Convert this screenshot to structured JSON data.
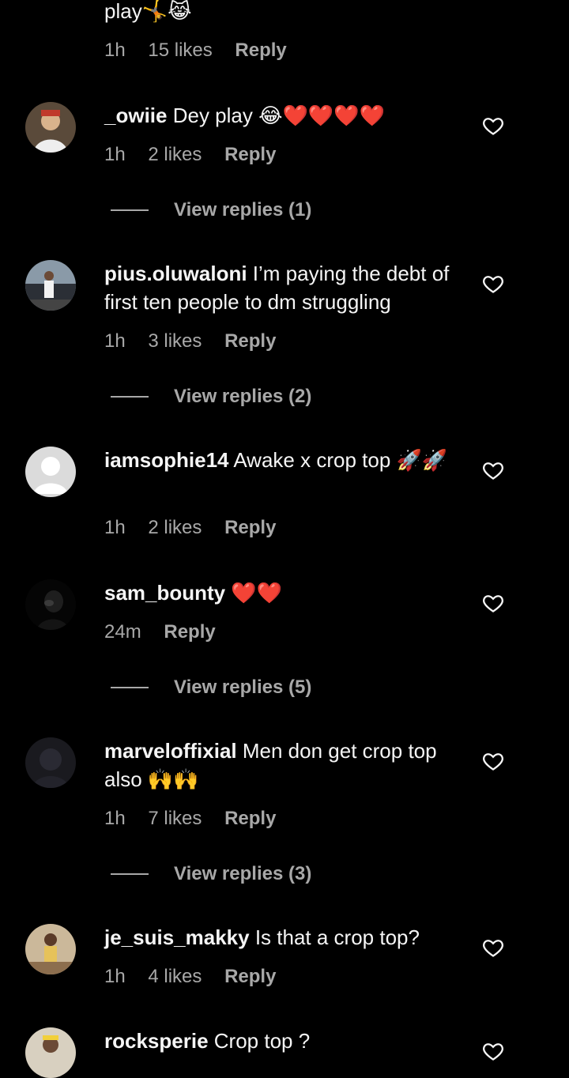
{
  "comments": [
    {
      "username": "",
      "text": "play🤸😹",
      "time": "1h",
      "likes": "15 likes",
      "reply_label": "Reply"
    },
    {
      "username": "_owiie",
      "text": "Dey play 😂❤️❤️❤️❤️",
      "time": "1h",
      "likes": "2 likes",
      "reply_label": "Reply",
      "view_replies": "View replies (1)"
    },
    {
      "username": "pius.oluwaloni",
      "text": "I’m paying the debt of first ten people to dm struggling",
      "time": "1h",
      "likes": "3 likes",
      "reply_label": "Reply",
      "view_replies": "View replies (2)"
    },
    {
      "username": "iamsophie14",
      "text": "Awake x crop top 🚀🚀",
      "time": "1h",
      "likes": "2 likes",
      "reply_label": "Reply"
    },
    {
      "username": "sam_bounty",
      "text": "❤️❤️",
      "time": "24m",
      "likes": "",
      "reply_label": "Reply",
      "view_replies": "View replies (5)"
    },
    {
      "username": "marveloffixial",
      "text": "Men don get crop top also 🙌🙌",
      "time": "1h",
      "likes": "7 likes",
      "reply_label": "Reply",
      "view_replies": "View replies (3)"
    },
    {
      "username": "je_suis_makky",
      "text": "Is that a crop top?",
      "time": "1h",
      "likes": "4 likes",
      "reply_label": "Reply"
    },
    {
      "username": "rocksperie",
      "text": "Crop top ?",
      "time": "",
      "likes": "",
      "reply_label": ""
    }
  ],
  "icons": {
    "like": "heart-outline-icon",
    "avatar_placeholder": "default-avatar-icon"
  },
  "colors": {
    "background": "#000000",
    "primary_text": "#f5f5f5",
    "secondary_text": "#a8a8a8"
  }
}
